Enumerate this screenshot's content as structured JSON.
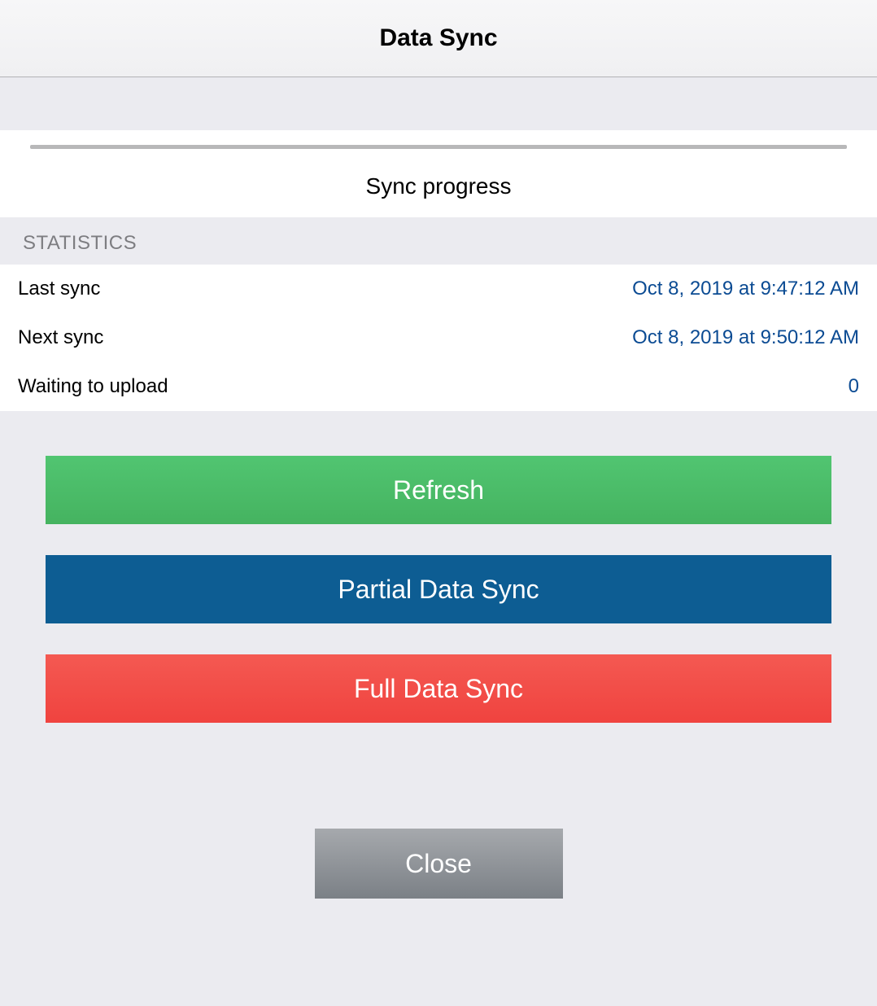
{
  "header": {
    "title": "Data Sync"
  },
  "progress": {
    "label": "Sync progress"
  },
  "sections": {
    "statistics_header": "STATISTICS"
  },
  "stats": {
    "last_sync": {
      "label": "Last sync",
      "value": "Oct 8, 2019 at 9:47:12 AM"
    },
    "next_sync": {
      "label": "Next sync",
      "value": "Oct 8, 2019 at 9:50:12 AM"
    },
    "waiting_upload": {
      "label": "Waiting to upload",
      "value": "0"
    }
  },
  "buttons": {
    "refresh": "Refresh",
    "partial": "Partial Data Sync",
    "full": "Full Data Sync",
    "close": "Close"
  }
}
